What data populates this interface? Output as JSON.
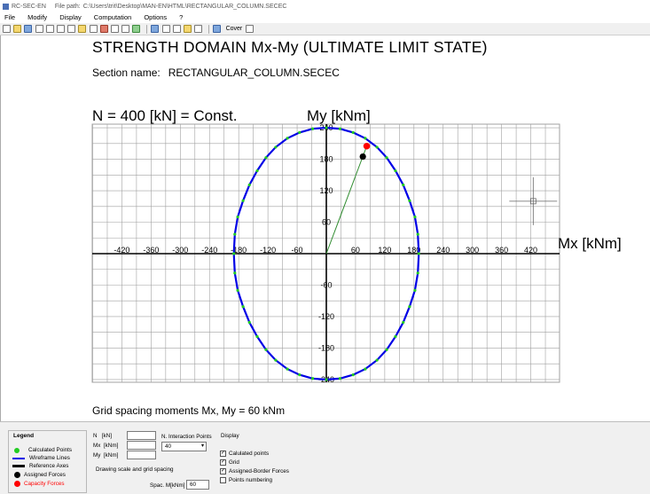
{
  "window": {
    "app_title": "RC-SEC-EN",
    "file_path_label": "File path:",
    "file_path": "C:\\Users\\trit\\Desktop\\MAN-EN\\HTML\\RECTANGULAR_COLUMN.SECEC"
  },
  "menu": [
    "File",
    "Modify",
    "Display",
    "Computation",
    "Options",
    "?"
  ],
  "toolbar": {
    "cover_label": "Cover",
    "icons": [
      "new-icon",
      "open-icon",
      "save-icon",
      "print-preview-icon",
      "copy-icon",
      "page-icon",
      "search-icon",
      "draw-icon",
      "edit-icon",
      "section-icon",
      "table-icon",
      "chart-icon",
      "globe-icon",
      "table-icon",
      "domain-icon",
      "report-icon",
      "image-icon",
      "print-icon",
      "cover-icon",
      "export-icon"
    ]
  },
  "plot": {
    "title": "STRENGTH DOMAIN Mx-My (ULTIMATE LIMIT STATE)",
    "section_label": "Section name:",
    "section_name": "RECTANGULAR_COLUMN.SECEC",
    "axial_force": "N = 400 [kN] = Const.",
    "my_label": "My  [kNm]",
    "mx_label": "Mx [kNm]",
    "grid_spacing_text": "Grid spacing moments Mx, My = 60 kNm",
    "colors": {
      "domain": "#0000e6",
      "calculated_points": "#22cc22",
      "assigned": "#000000",
      "capacity": "#ff0000",
      "line_to_capacity": "#2e8b2e",
      "grid": "#a0a0a0",
      "axes": "#000000"
    }
  },
  "chart_data": {
    "type": "scatter",
    "title": "STRENGTH DOMAIN Mx-My (ULTIMATE LIMIT STATE)",
    "xlabel": "Mx [kNm]",
    "ylabel": "My  [kNm]",
    "xlim": [
      -480,
      480
    ],
    "ylim": [
      -240,
      252
    ],
    "grid": true,
    "x_ticks": [
      -420,
      -360,
      -300,
      -240,
      -180,
      -120,
      -60,
      60,
      120,
      180,
      240,
      300,
      360,
      420
    ],
    "y_ticks": [
      -240,
      -180,
      -120,
      -60,
      60,
      120,
      180,
      240
    ],
    "domain_points": [
      [
        0,
        240
      ],
      [
        28,
        238
      ],
      [
        55,
        231
      ],
      [
        80,
        220
      ],
      [
        104,
        203
      ],
      [
        124,
        183
      ],
      [
        142,
        158
      ],
      [
        158,
        131
      ],
      [
        171,
        101
      ],
      [
        182,
        70
      ],
      [
        188,
        37
      ],
      [
        190,
        0
      ],
      [
        188,
        -37
      ],
      [
        182,
        -70
      ],
      [
        171,
        -101
      ],
      [
        158,
        -131
      ],
      [
        142,
        -158
      ],
      [
        124,
        -183
      ],
      [
        104,
        -203
      ],
      [
        80,
        -220
      ],
      [
        55,
        -231
      ],
      [
        28,
        -238
      ],
      [
        0,
        -240
      ],
      [
        -28,
        -238
      ],
      [
        -55,
        -231
      ],
      [
        -80,
        -220
      ],
      [
        -104,
        -203
      ],
      [
        -124,
        -183
      ],
      [
        -142,
        -158
      ],
      [
        -158,
        -131
      ],
      [
        -171,
        -101
      ],
      [
        -182,
        -70
      ],
      [
        -188,
        -37
      ],
      [
        -190,
        0
      ],
      [
        -188,
        37
      ],
      [
        -182,
        70
      ],
      [
        -171,
        101
      ],
      [
        -158,
        131
      ],
      [
        -142,
        158
      ],
      [
        -124,
        183
      ],
      [
        -104,
        203
      ],
      [
        -80,
        220
      ],
      [
        -55,
        231
      ],
      [
        -28,
        238
      ]
    ],
    "assigned_force": [
      75,
      185
    ],
    "capacity_force": [
      83,
      205
    ],
    "cursor": [
      425,
      100
    ]
  },
  "legend": {
    "title": "Legend",
    "items": [
      {
        "label": "Calculated Points",
        "kind": "dot",
        "color": "#22cc22"
      },
      {
        "label": "Wireframe Lines",
        "kind": "line",
        "color": "#0000e6"
      },
      {
        "label": "Reference Axes",
        "kind": "line",
        "color": "#000000"
      },
      {
        "label": "Assigned Forces",
        "kind": "dot",
        "color": "#000000"
      },
      {
        "label": "Capacity Forces",
        "kind": "dot",
        "color": "#ff0000"
      }
    ]
  },
  "inputs": {
    "n_label": "N",
    "n_unit": "[kN]",
    "mx_label": "Mx",
    "mx_unit": "[kNm]",
    "my_label": "My",
    "my_unit": "[kNm]",
    "interaction_label": "N. Interaction Points",
    "interaction_value": "40",
    "drawing_scale_label": "Drawing scale and grid spacing",
    "spac_label": "Spac. M[kNm]",
    "spac_value": "60"
  },
  "display": {
    "title": "Display",
    "options": [
      {
        "label": "Calulated points",
        "checked": true
      },
      {
        "label": "Grid",
        "checked": true
      },
      {
        "label": "Assigned-Border Forces",
        "checked": true
      },
      {
        "label": "Points numbering",
        "checked": false
      }
    ]
  }
}
